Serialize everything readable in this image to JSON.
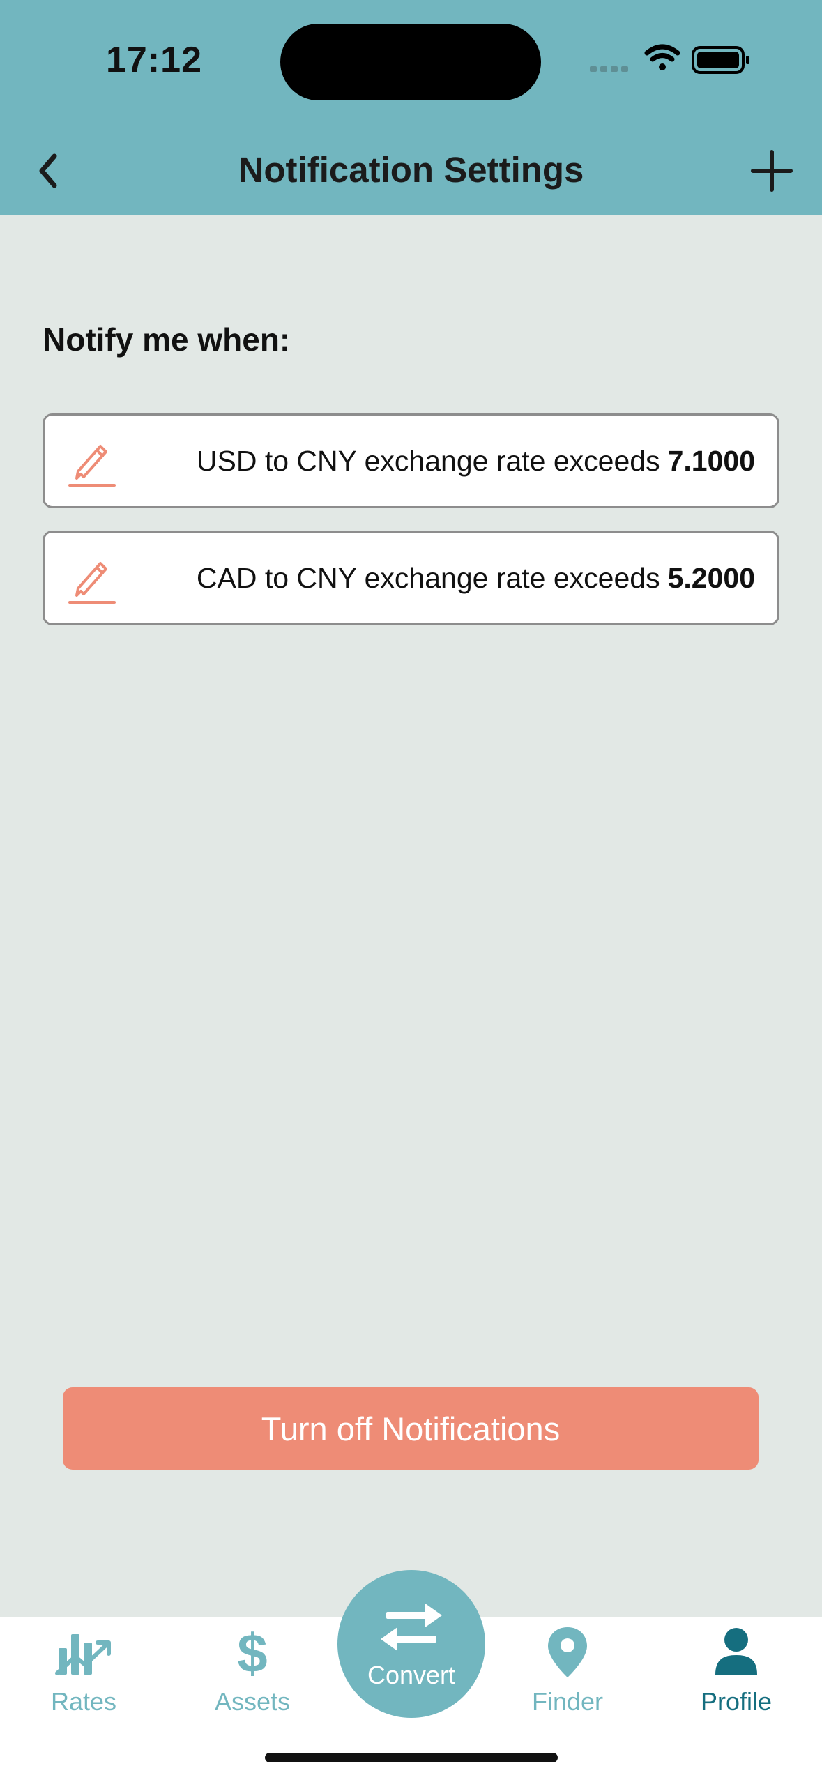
{
  "status_bar": {
    "time": "17:12"
  },
  "nav": {
    "title": "Notification Settings",
    "back_icon": "chevron-left-icon",
    "add_icon": "plus-icon"
  },
  "section": {
    "title": "Notify me when:"
  },
  "rules": [
    {
      "text": "USD to CNY exchange rate exceeds",
      "threshold": "7.1000",
      "icon": "pencil-icon"
    },
    {
      "text": "CAD to CNY exchange rate exceeds",
      "threshold": "5.2000",
      "icon": "pencil-icon"
    }
  ],
  "turn_off_button": {
    "label": "Turn off Notifications"
  },
  "tabs": [
    {
      "label": "Rates",
      "icon": "chart-icon",
      "active": false
    },
    {
      "label": "Assets",
      "icon": "dollar-icon",
      "active": false
    },
    {
      "label": "Convert",
      "icon": "swap-arrows-icon",
      "active": false
    },
    {
      "label": "Finder",
      "icon": "location-pin-icon",
      "active": false
    },
    {
      "label": "Profile",
      "icon": "person-icon",
      "active": true
    }
  ],
  "colors": {
    "header": "#72b6bf",
    "background": "#e2e8e5",
    "accent": "#ee8c76",
    "tab_inactive": "#72b6bf",
    "tab_active": "#156e7f"
  }
}
